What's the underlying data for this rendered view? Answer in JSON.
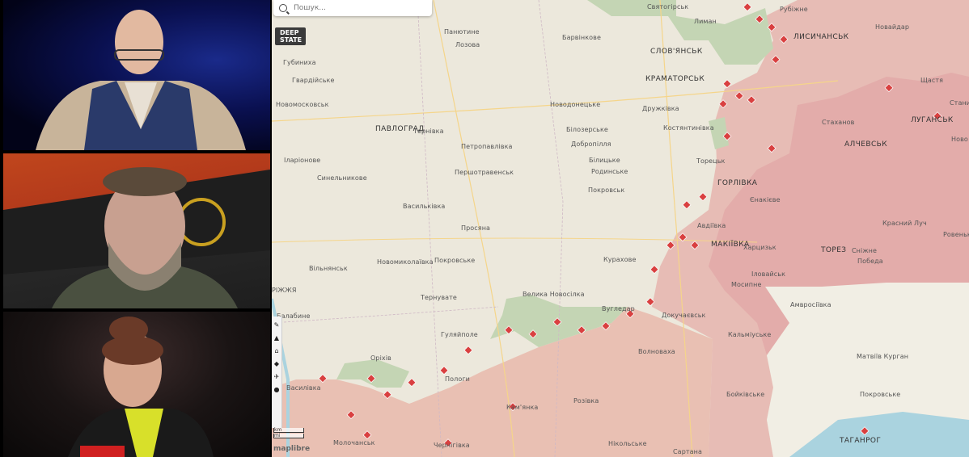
{
  "search": {
    "placeholder": "Пошук..."
  },
  "logo": {
    "line1": "DEEP",
    "line2": "STATE"
  },
  "attribution": "maplibre",
  "scale": {
    "top": "km",
    "bottom": "mi"
  },
  "icons": [
    "search-icon",
    "map-tool-icon"
  ],
  "colors": {
    "occupied": "#e6b1a6",
    "contested": "#ecc3b5",
    "liberated": "#bfd1b0",
    "base": "#ece8dc",
    "marker": "#d94040"
  },
  "labels": {
    "svyatohirsk": "Святогірськ",
    "lyman": "Лиман",
    "rubizhne": "Рубіжне",
    "lysychansk": "ЛИСИЧАНСЬК",
    "novaidar": "Новайдар",
    "shchastia": "Щастя",
    "stanytsia": "Станиц",
    "luhansk": "ЛУГАНСЬК",
    "novo": "Ново",
    "panyutyne": "Панютине",
    "barvinkove": "Барвінкове",
    "lozova": "Лозова",
    "slovyansk": "СЛОВ'ЯНСЬК",
    "kramatorsk": "КРАМАТОРСЬК",
    "hubynykha": "Губиниха",
    "hvardiiske": "Гвардійське",
    "novomoskovsk": "Новомосковськ",
    "novodonetske": "Новодонецьке",
    "druzhkivka": "Дружківка",
    "kostiantynivka": "Костянтинівка",
    "pavlohrad": "ПАВЛОГРАД",
    "ternivka": "Тернівка",
    "bilozerske": "Білозерське",
    "dobropillia": "Добропілля",
    "stakhanov": "Стаханов",
    "alchevsk": "АЛЧЕВСЬК",
    "petropavlivka": "Петропавлівка",
    "bilytske": "Білицьке",
    "toretsk": "Торецьк",
    "ilarionove": "Іларіонове",
    "pershotravensk": "Першотравенськ",
    "rodynske": "Родинське",
    "synelnykove": "Синельникове",
    "pokrovsk": "Покровськ",
    "horlivka": "ГОРЛІВКА",
    "yenakiieve": "Єнакієве",
    "vasylkivka": "Васильківка",
    "krasnyi_luch": "Красний Луч",
    "prosiana": "Просяна",
    "avdiivka": "Авдіївка",
    "makiivka": "МАКІЇВКА",
    "khartsyzk": "Харцизьк",
    "torez": "ТОРЕЗ",
    "snizhne": "Сніжне",
    "rovenky": "Ровеньки",
    "vilniansk": "Вільнянськ",
    "novomykolaivka": "Новомиколаївка",
    "pokrovske": "Покровське",
    "kurakhove": "Курахове",
    "pobeda": "Победа",
    "zaporizhzhia": "РІЖЖЯ",
    "ilovaisk": "Іловайськ",
    "mospyne": "Мосипне",
    "velyka_novosilka": "Велика Новосілка",
    "ternuvate": "Тернувате",
    "amvrosiivka": "Амвросіївка",
    "babalyne": "Балабине",
    "huliaipole": "Гуляйполе",
    "vuhledar": "Вугледар",
    "dokuchaievsk": "Докучаєвськ",
    "kalmiuske": "Кальміуське",
    "orikhiv": "Оріхів",
    "volnovakha": "Волноваха",
    "matviiv_kurhan": "Матвіїв Курган",
    "vasylivka": "Василівка",
    "polohy": "Пологи",
    "boikivske": "Бойківське",
    "pokrovske2": "Покровське",
    "rozivka": "Розівка",
    "kamianka": "Кам'янка",
    "molochansk": "Молочанськ",
    "chernihivka": "Чернігівка",
    "nikolske": "Нікольське",
    "sartana": "Сартана",
    "tahanrih": "ТАГАНРОГ"
  }
}
